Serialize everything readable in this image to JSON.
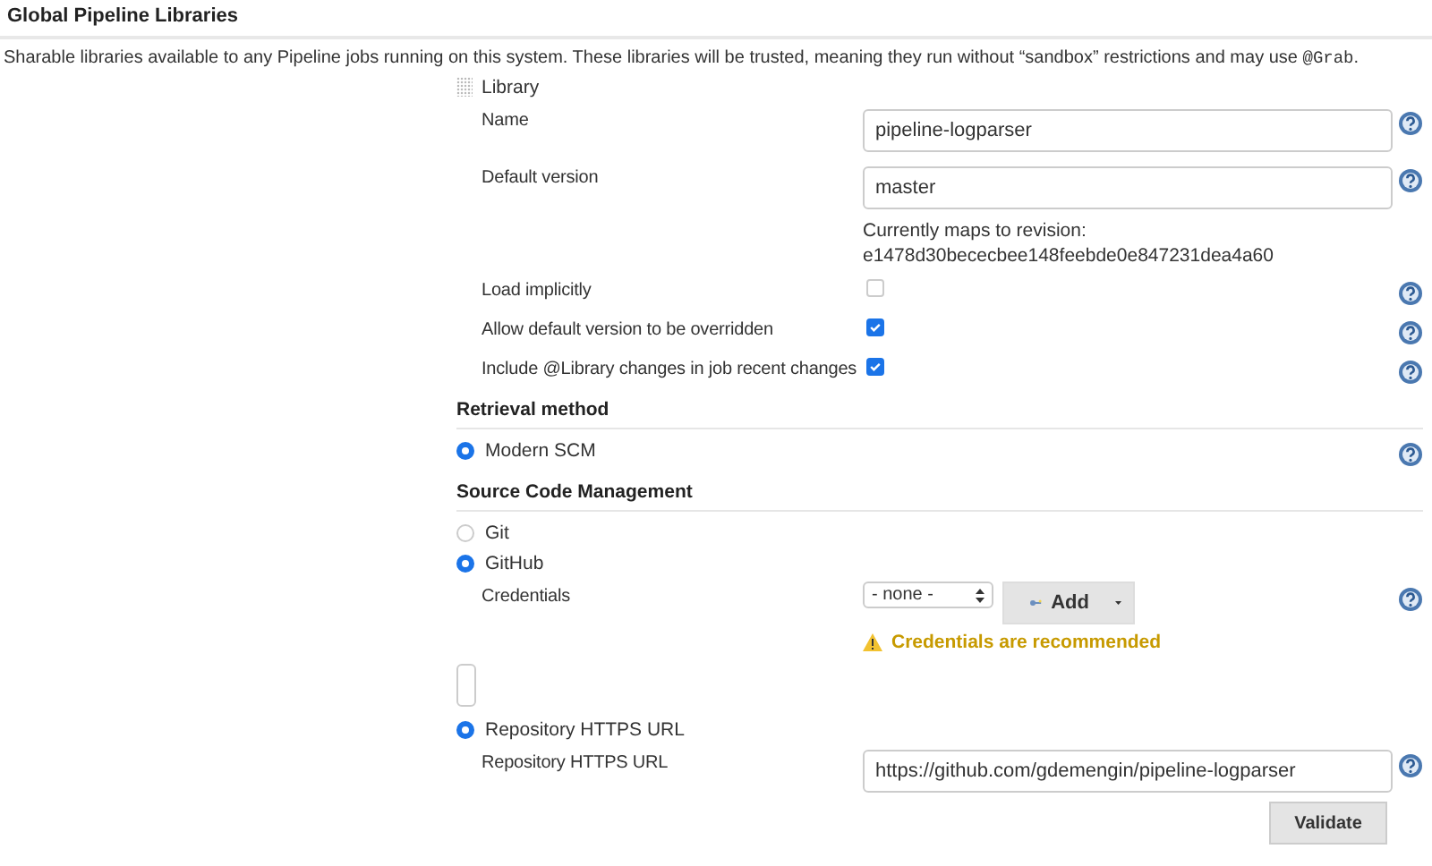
{
  "section_title": "Global Pipeline Libraries",
  "description": {
    "text": "Sharable libraries available to any Pipeline jobs running on this system. These libraries will be trusted, meaning they run without “sandbox” restrictions and may use",
    "code": "@Grab",
    "end": "."
  },
  "library": {
    "label": "Library",
    "rows": [
      {
        "kind": "text",
        "label": "Name",
        "value": "pipeline-logparser"
      },
      {
        "kind": "text",
        "label": "Default version",
        "value": "master",
        "note": [
          "Currently maps to revision:",
          "e1478d30bececbee148feebde0e847231dea4a60"
        ]
      },
      {
        "kind": "checkbox",
        "label": "Load implicitly",
        "checked": false
      },
      {
        "kind": "checkbox",
        "label": "Allow default version to be overridden",
        "checked": true
      },
      {
        "kind": "checkbox",
        "label": "Include @Library changes in job recent changes",
        "checked": true
      }
    ]
  },
  "retrieval": {
    "heading": "Retrieval method",
    "options": [
      {
        "label": "Modern SCM",
        "selected": true
      }
    ]
  },
  "scm": {
    "heading": "Source Code Management",
    "options": [
      {
        "label": "Git",
        "selected": false
      },
      {
        "label": "GitHub",
        "selected": true
      }
    ],
    "credentials": {
      "label": "Credentials",
      "select": "- none -",
      "add_button": "Add",
      "warning": "Credentials are recommended"
    },
    "repo_options": [
      {
        "label": "Repository HTTPS URL",
        "selected": true
      }
    ],
    "repo_url": {
      "label": "Repository HTTPS URL",
      "value": "https://github.com/gdemengin/pipeline-logparser"
    },
    "validate_button": "Validate"
  }
}
